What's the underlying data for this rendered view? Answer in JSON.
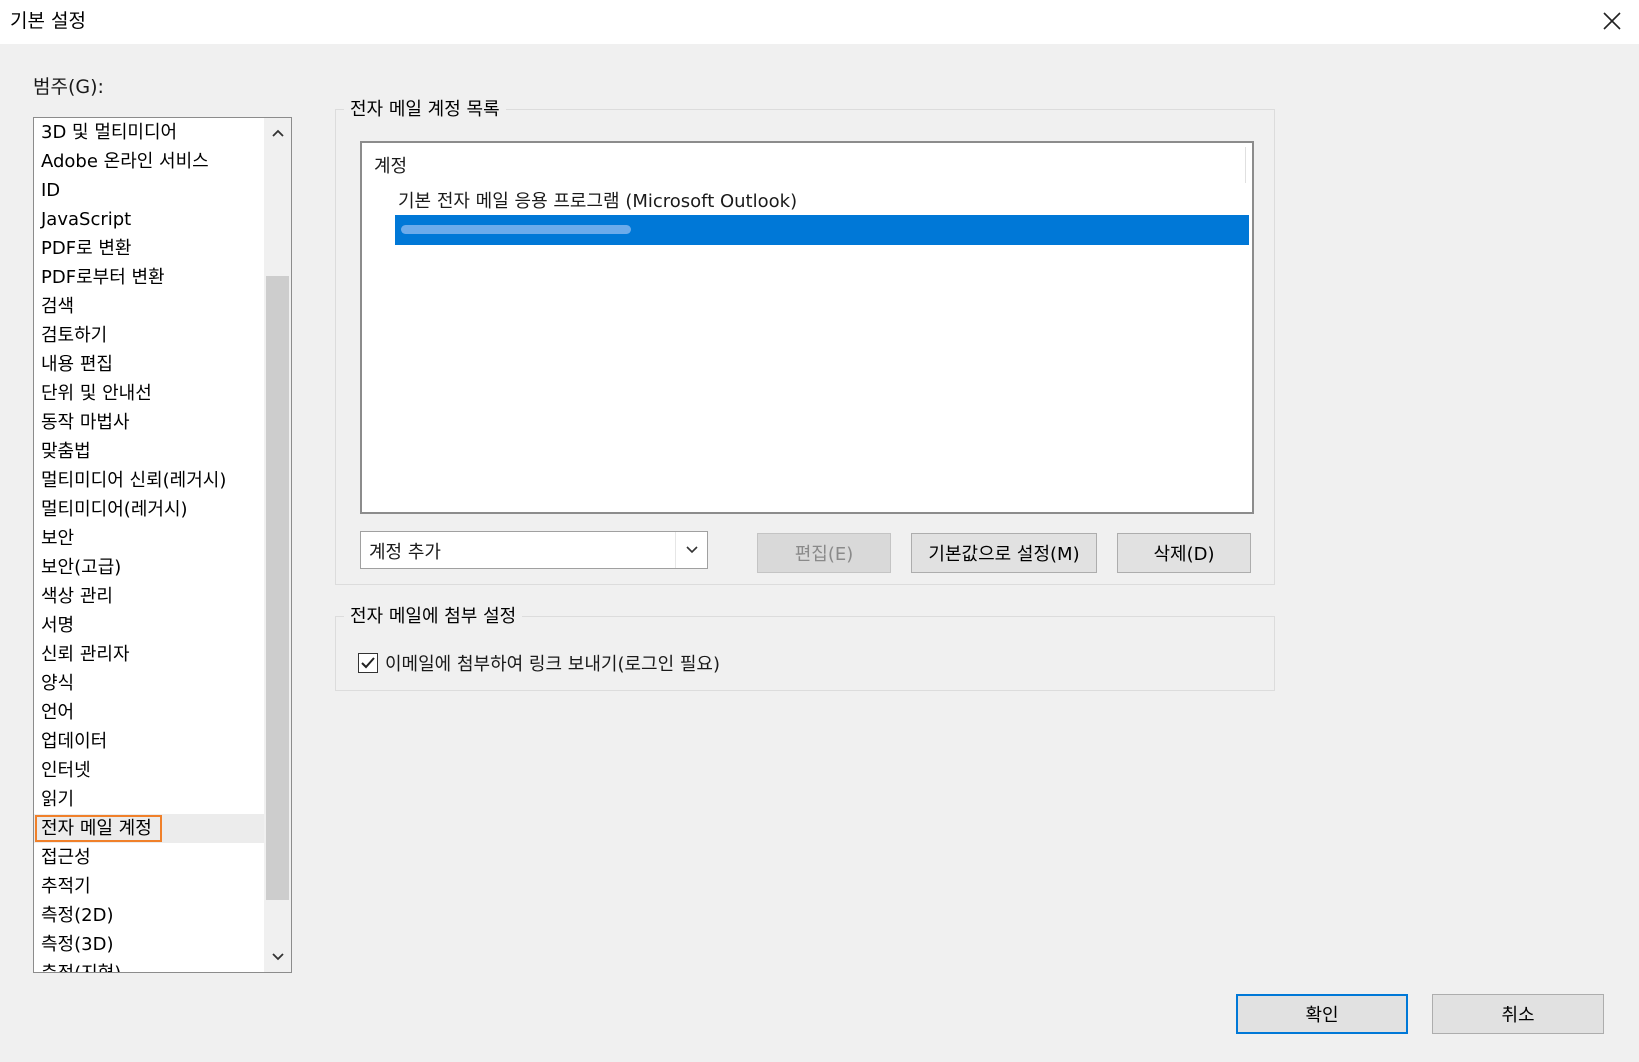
{
  "window": {
    "title": "기본 설정"
  },
  "category": {
    "label": "범주(G):",
    "items": [
      "3D 및 멀티미디어",
      "Adobe 온라인 서비스",
      "ID",
      "JavaScript",
      "PDF로 변환",
      "PDF로부터 변환",
      "검색",
      "검토하기",
      "내용 편집",
      "단위 및 안내선",
      "동작 마법사",
      "맞춤법",
      "멀티미디어 신뢰(레거시)",
      "멀티미디어(레거시)",
      "보안",
      "보안(고급)",
      "색상 관리",
      "서명",
      "신뢰 관리자",
      "양식",
      "언어",
      "업데이터",
      "인터넷",
      "읽기",
      "전자 메일 계정",
      "접근성",
      "추적기",
      "측정(2D)",
      "측정(3D)",
      "측정(지형)"
    ],
    "selected_index": 24
  },
  "accounts": {
    "group_title": "전자 메일 계정 목록",
    "column_header": "계정",
    "default_item": "기본 전자 메일 응용 프로그램 (Microsoft Outlook)",
    "combo_value": "계정 추가",
    "buttons": {
      "edit": "편집(E)",
      "set_default": "기본값으로 설정(M)",
      "delete": "삭제(D)"
    }
  },
  "attachment": {
    "group_title": "전자 메일에 첨부 설정",
    "checkbox_label": "이메일에 첨부하여 링크 보내기(로그인 필요)",
    "checkbox_checked": true
  },
  "footer": {
    "ok": "확인",
    "cancel": "취소"
  },
  "colors": {
    "selection": "#0078d7",
    "highlight_border": "#f0802a"
  }
}
